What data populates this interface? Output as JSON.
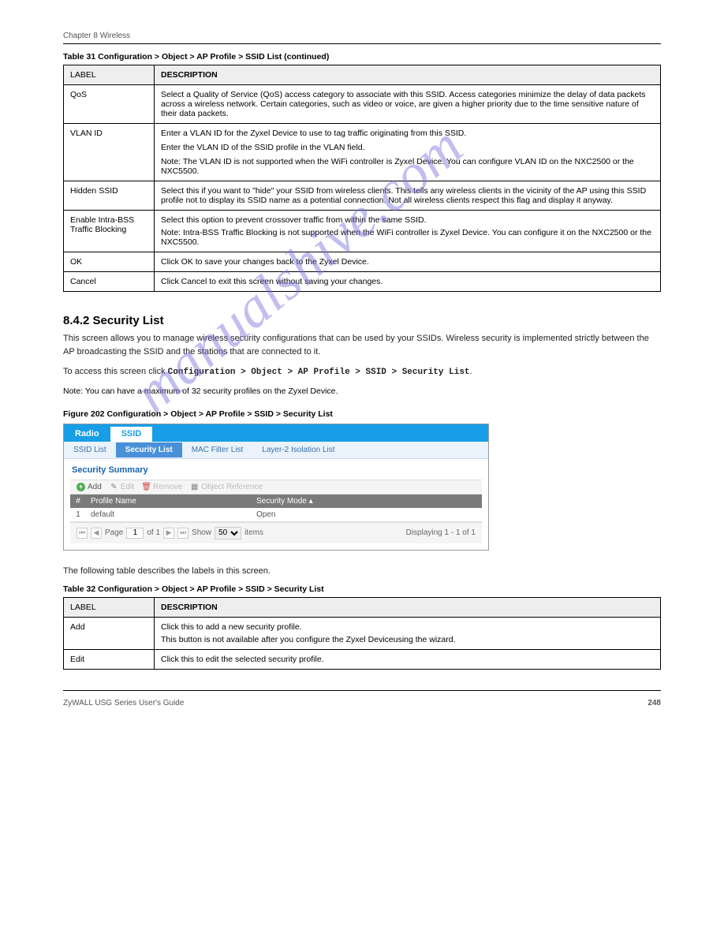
{
  "header": {
    "chapter": "Chapter 8 Wireless"
  },
  "footer": {
    "product": "ZyWALL USG Series User's Guide",
    "page": "248"
  },
  "table31": {
    "caption": "Table 31   Configuration > Object > AP Profile > SSID List (continued)",
    "head_label": "LABEL",
    "head_desc": "DESCRIPTION",
    "rows": [
      {
        "label": "QoS",
        "desc": "Select a Quality of Service (QoS) access category to associate with this SSID. Access categories minimize the delay of data packets across a wireless network. Certain categories, such as video or voice, are given a higher priority due to the time sensitive nature of their data packets."
      },
      {
        "label": "VLAN ID",
        "desc_lines": [
          "Enter a VLAN ID for the Zyxel Device to use to tag traffic originating from this SSID.",
          "Enter the VLAN ID of the SSID profile in the VLAN field.",
          "Note: The VLAN ID is not supported when the WiFi controller is Zyxel Device. You can configure VLAN ID on the NXC2500 or the NXC5500."
        ]
      },
      {
        "label": "Hidden SSID",
        "desc": "Select this if you want to \"hide\" your SSID from wireless clients. This tells any wireless clients in the vicinity of the AP using this SSID profile not to display its SSID name as a potential connection. Not all wireless clients respect this flag and display it anyway."
      },
      {
        "label": "Enable Intra-BSS Traffic Blocking",
        "desc": "Select this option to prevent crossover traffic from within the same SSID.",
        "desc2": "Note: Intra-BSS Traffic Blocking is not supported when the WiFi controller is Zyxel Device. You can configure it on the NXC2500 or the NXC5500."
      },
      {
        "label": "OK",
        "desc": "Click OK to save your changes back to the Zyxel Device."
      },
      {
        "label": "Cancel",
        "desc": "Click Cancel to exit this screen without saving your changes."
      }
    ]
  },
  "section": {
    "num": "8.4.2  Security List",
    "para": "This screen allows you to manage wireless security configurations that can be used by your SSIDs. Wireless security is implemented strictly between the AP broadcasting the SSID and the stations that are connected to it.",
    "navnote_prefix": "To access this screen click ",
    "navnote_path": "Configuration > Object > AP Profile > SSID > Security List",
    "note": "Note: You can have a maximum of 32 security profiles on the Zyxel Device."
  },
  "figure": {
    "caption": "Figure 202   Configuration > Object > AP Profile > SSID > Security List",
    "tabs1": [
      {
        "label": "Radio",
        "active": false
      },
      {
        "label": "SSID",
        "active": true
      }
    ],
    "tabs2": [
      {
        "label": "SSID List",
        "active": false
      },
      {
        "label": "Security List",
        "active": true
      },
      {
        "label": "MAC Filter List",
        "active": false
      },
      {
        "label": "Layer-2 Isolation List",
        "active": false
      }
    ],
    "summary_title": "Security Summary",
    "toolbar": {
      "add": "Add",
      "edit": "Edit",
      "remove": "Remove",
      "ref": "Object Reference"
    },
    "columns": {
      "idx": "#",
      "name": "Profile Name",
      "mode": "Security Mode ▴"
    },
    "rows": [
      {
        "idx": "1",
        "name": "default",
        "mode": "Open"
      }
    ],
    "pager": {
      "page_label": "Page",
      "page_value": "1",
      "of_label": "of 1",
      "show_label": "Show",
      "show_value": "50",
      "items_label": "items",
      "status": "Displaying 1 - 1 of 1"
    }
  },
  "table32": {
    "intro": "The following table describes the labels in this screen.",
    "caption": "Table 32   Configuration > Object > AP Profile > SSID > Security List",
    "head_label": "LABEL",
    "head_desc": "DESCRIPTION",
    "rows": [
      {
        "label": "Add",
        "desc": "Click this to add a new security profile.",
        "desc2": "This button is not available after you configure the Zyxel Deviceusing the wizard."
      },
      {
        "label": "Edit",
        "desc": "Click this to edit the selected security profile."
      }
    ]
  },
  "watermark": "manualshive.com"
}
